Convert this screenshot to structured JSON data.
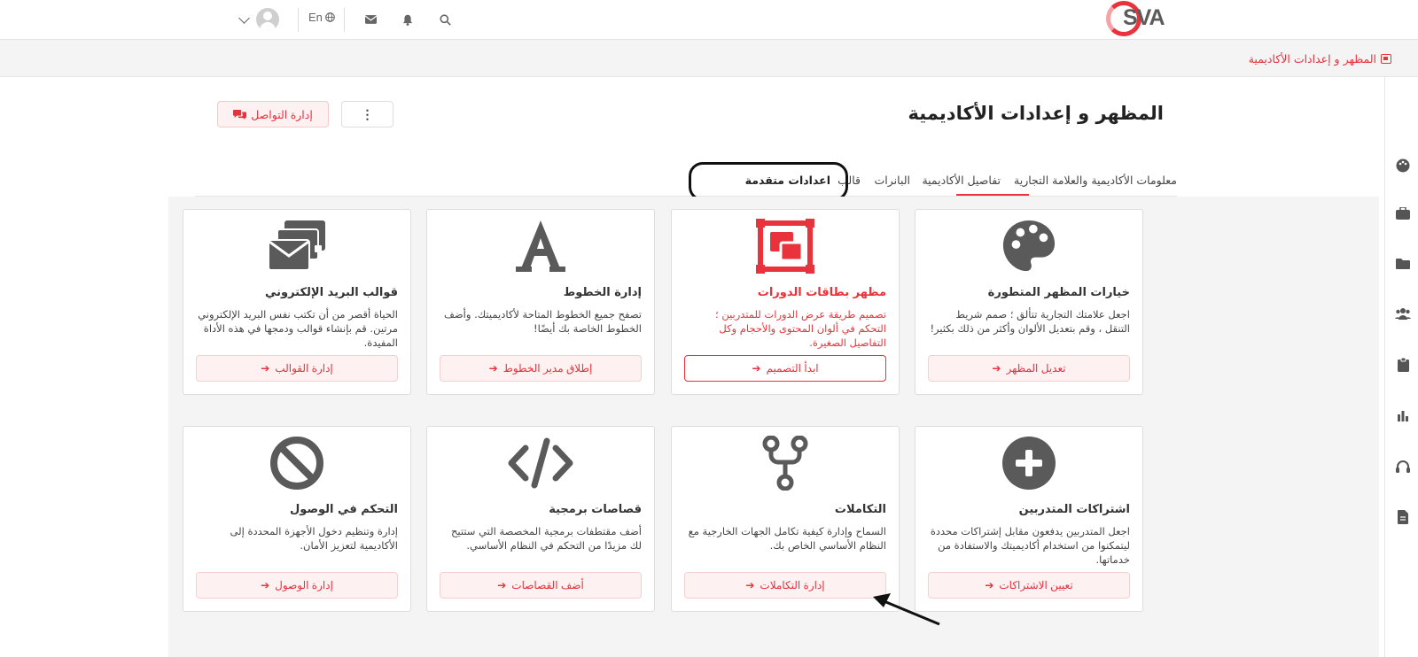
{
  "header": {
    "logo_text": "SVA",
    "lang_label": "En"
  },
  "breadcrumb": {
    "label": "المظهر و إعدادات الأكاديمية"
  },
  "page": {
    "title": "المظهر و إعدادات الأكاديمية",
    "comm_button": "إدارة التواصل",
    "more_button": "⋮"
  },
  "tabs": [
    {
      "label": "معلومات الأكاديمية والعلامة التجارية"
    },
    {
      "label": "تفاصيل الأكاديمية"
    },
    {
      "label": "البانرات"
    },
    {
      "label": "قالب"
    },
    {
      "label": "اعدادات متقدمة",
      "active": true
    }
  ],
  "cards": [
    {
      "title": "خيارات المظهر المتطورة",
      "desc": "اجعل علامتك التجارية تتألق ؛ صمم شريط التنقل ، وقم بتعديل الألوان وأكثر من ذلك بكثير!",
      "action": "تعديل المظهر",
      "icon": "palette-icon"
    },
    {
      "title": "مظهر بطاقات الدورات",
      "desc": "تصميم طريقة عرض الدورات للمتدربين ؛ التحكم في ألوان المحتوى والأحجام وكل التفاصيل الصغيرة.",
      "action": "ابدأ التصميم",
      "icon": "layout-icon"
    },
    {
      "title": "إدارة الخطوط",
      "desc": "تصفح جميع الخطوط المتاحة لأكاديميتك. وأضف الخطوط الخاصة بك أيضًا!",
      "action": "إطلاق مدير الخطوط",
      "icon": "font-icon"
    },
    {
      "title": "قوالب البريد الإلكتروني",
      "desc": "الحياة أقصر من أن تكتب نفس البريد الإلكتروني مرتين. قم بإنشاء قوالب ودمجها في هذه الأداة المفيدة.",
      "action": "إدارة القوالب",
      "icon": "mail-icon"
    },
    {
      "title": "اشتراكات المتدربين",
      "desc": "اجعل المتدربين يدفعون مقابل إشتراكات محددة ليتمكنوا من استخدام أكاديميتك والاستفادة من خدماتها.",
      "action": "تعيين الاشتراكات",
      "icon": "plus-circle-icon"
    },
    {
      "title": "التكاملات",
      "desc": "السماح وإدارة كيفية تكامل الجهات الخارجية مع النظام الأساسي الخاص بك.",
      "action": "إدارة التكاملات",
      "icon": "fork-icon"
    },
    {
      "title": "قصاصات برمجية",
      "desc": "أضف مقتطفات برمجية المخصصة التي ستتيح لك مزيدًا من التحكم في النظام الأساسي.",
      "action": "أضف القصاصات",
      "icon": "code-icon"
    },
    {
      "title": "التحكم في الوصول",
      "desc": "إدارة وتنظيم دخول الأجهزة المحددة إلى الأكاديمية لتعزيز الأمان.",
      "action": "إدارة الوصول",
      "icon": "ban-icon"
    }
  ],
  "colors": {
    "accent": "#e8323c",
    "icon": "#5a5a5a"
  }
}
